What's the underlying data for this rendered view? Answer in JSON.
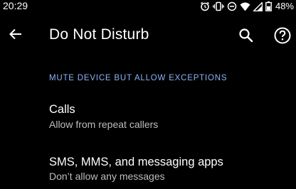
{
  "status_bar": {
    "time": "20:29",
    "battery_percent": "48%",
    "icons": [
      "alarm-icon",
      "vibrate-icon",
      "do-not-disturb-icon",
      "wifi-icon",
      "cell-signal-icon",
      "battery-icon"
    ]
  },
  "app_bar": {
    "title": "Do Not Disturb",
    "icons": [
      "back-arrow-icon",
      "search-icon",
      "help-icon"
    ]
  },
  "section": {
    "header": "MUTE DEVICE BUT ALLOW EXCEPTIONS",
    "items": [
      {
        "title": "Calls",
        "summary": "Allow from repeat callers"
      },
      {
        "title": "SMS, MMS, and messaging apps",
        "summary": "Don’t allow any messages"
      }
    ]
  },
  "colors": {
    "background": "#000000",
    "text_primary": "#ffffff",
    "text_secondary": "#bdbdbd",
    "accent": "#8ab4f8"
  }
}
